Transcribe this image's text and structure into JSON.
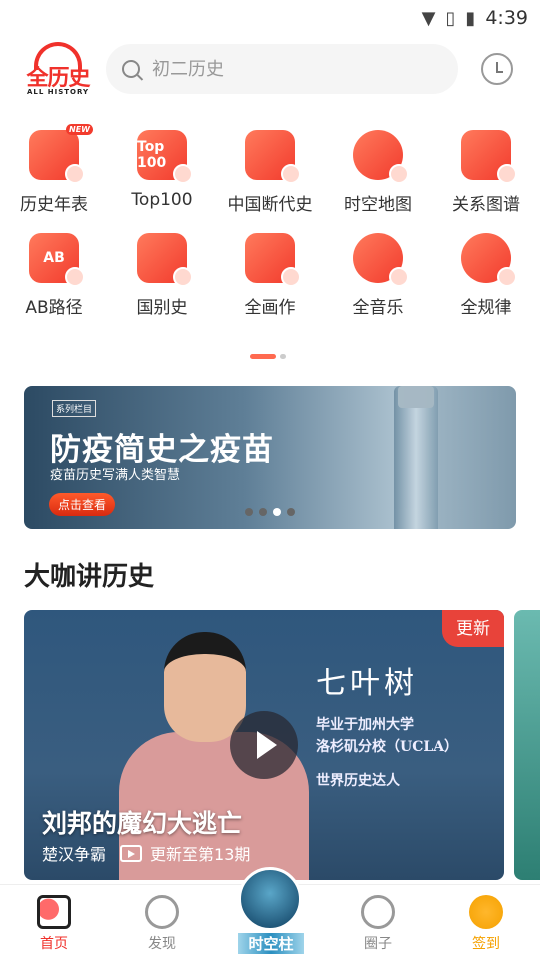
{
  "status": {
    "time": "4:39"
  },
  "header": {
    "logo_cn": "全历史",
    "logo_en": "ALL HISTORY",
    "search_placeholder": "初二历史"
  },
  "grid": [
    {
      "label": "历史年表",
      "icon": "calendar-globe-icon",
      "glyph": "",
      "badge": "NEW"
    },
    {
      "label": "Top100",
      "icon": "top100-icon",
      "glyph": "Top 100"
    },
    {
      "label": "中国断代史",
      "icon": "china-dynasty-icon",
      "glyph": ""
    },
    {
      "label": "时空地图",
      "icon": "map-globe-icon",
      "glyph": ""
    },
    {
      "label": "关系图谱",
      "icon": "relation-graph-icon",
      "glyph": ""
    },
    {
      "label": "AB路径",
      "icon": "ab-path-icon",
      "glyph": "AB"
    },
    {
      "label": "国别史",
      "icon": "flag-icon",
      "glyph": ""
    },
    {
      "label": "全画作",
      "icon": "painting-icon",
      "glyph": ""
    },
    {
      "label": "全音乐",
      "icon": "music-icon",
      "glyph": ""
    },
    {
      "label": "全规律",
      "icon": "cycle-icon",
      "glyph": ""
    }
  ],
  "banner": {
    "tag": "系列栏目",
    "title": "防疫简史之疫苗",
    "subtitle": "疫苗历史写满人类智慧",
    "button": "点击查看",
    "active_dot": 3,
    "dot_count": 4
  },
  "section_title": "大咖讲历史",
  "card": {
    "badge": "更新",
    "speaker": "七叶树",
    "desc_line1": "毕业于加州大学",
    "desc_line2": "洛杉矶分校（UCLA）",
    "desc_line3": "世界历史达人",
    "title": "刘邦的魔幻大逃亡",
    "series": "楚汉争霸",
    "progress": "更新至第13期"
  },
  "nav": [
    {
      "label": "首页",
      "icon": "home-icon",
      "active": true
    },
    {
      "label": "发现",
      "icon": "compass-icon"
    },
    {
      "label": "时空柱",
      "icon": "time-pillar-icon"
    },
    {
      "label": "圈子",
      "icon": "chat-bubble-icon"
    },
    {
      "label": "签到",
      "icon": "check-in-icon"
    }
  ],
  "colors": {
    "accent": "#f0312b",
    "signin": "#f5a100"
  }
}
